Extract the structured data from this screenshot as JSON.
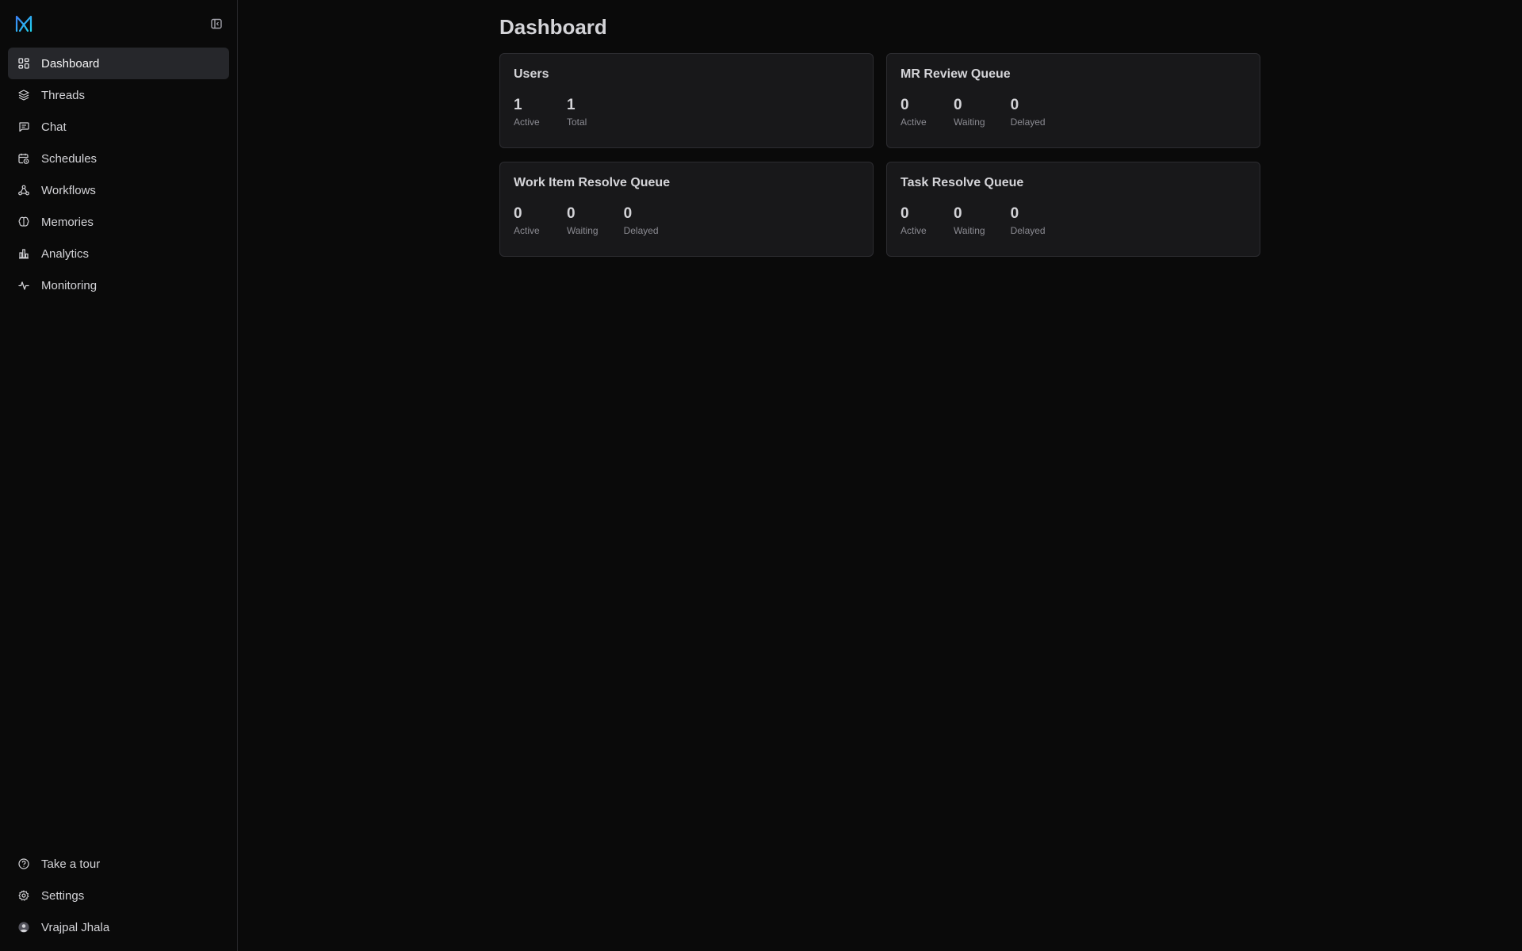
{
  "sidebar": {
    "items": [
      {
        "label": "Dashboard",
        "icon": "dashboard-grid-icon",
        "active": true
      },
      {
        "label": "Threads",
        "icon": "layers-icon"
      },
      {
        "label": "Chat",
        "icon": "chat-bubble-icon"
      },
      {
        "label": "Schedules",
        "icon": "calendar-clock-icon"
      },
      {
        "label": "Workflows",
        "icon": "workflow-icon"
      },
      {
        "label": "Memories",
        "icon": "brain-icon"
      },
      {
        "label": "Analytics",
        "icon": "bar-chart-icon"
      },
      {
        "label": "Monitoring",
        "icon": "activity-icon"
      }
    ],
    "footer": [
      {
        "label": "Take a tour",
        "icon": "help-circle-icon"
      },
      {
        "label": "Settings",
        "icon": "gear-icon"
      },
      {
        "label": "Vrajpal Jhala",
        "icon": "avatar"
      }
    ]
  },
  "main": {
    "title": "Dashboard",
    "cards": [
      {
        "title": "Users",
        "stats": [
          {
            "value": "1",
            "label": "Active"
          },
          {
            "value": "1",
            "label": "Total"
          }
        ]
      },
      {
        "title": "MR Review Queue",
        "stats": [
          {
            "value": "0",
            "label": "Active"
          },
          {
            "value": "0",
            "label": "Waiting"
          },
          {
            "value": "0",
            "label": "Delayed"
          }
        ]
      },
      {
        "title": "Work Item Resolve Queue",
        "stats": [
          {
            "value": "0",
            "label": "Active"
          },
          {
            "value": "0",
            "label": "Waiting"
          },
          {
            "value": "0",
            "label": "Delayed"
          }
        ]
      },
      {
        "title": "Task Resolve Queue",
        "stats": [
          {
            "value": "0",
            "label": "Active"
          },
          {
            "value": "0",
            "label": "Waiting"
          },
          {
            "value": "0",
            "label": "Delayed"
          }
        ]
      }
    ]
  },
  "colors": {
    "background": "#0a0a0a",
    "card": "#18181a",
    "card_border": "#2c2c30",
    "active_nav": "#26272b",
    "logo_accent": "#22d3ee"
  }
}
